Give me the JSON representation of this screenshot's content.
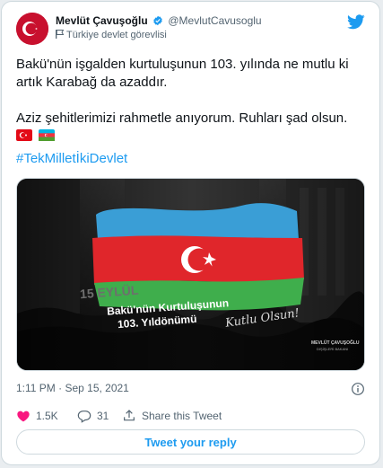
{
  "author": {
    "name": "Mevlüt Çavuşoğlu",
    "handle": "@MevlutCavusoglu",
    "label": "Türkiye devlet görevlisi"
  },
  "tweet": {
    "paragraph1": "Bakü'nün işgalden kurtuluşunun 103. yılında ne mutlu ki artık Karabağ da azaddır.",
    "paragraph2": "Aziz şehitlerimizi rahmetle anıyorum. Ruhları şad olsun.",
    "emoji_flags": [
      "flag-turkey",
      "flag-azerbaijan"
    ],
    "hashtag": "#TekMilletİkiDevlet"
  },
  "media": {
    "date_text": "15 EYLÜL",
    "title_line1": "Bakü'nün Kurtuluşunun",
    "title_line2": "103. Yıldönümü",
    "handwriting": "Kutlu Olsun!",
    "signature_name": "MEVLÜT ÇAVUŞOĞLU",
    "signature_title": "DIŞİŞLERİ BAKANI",
    "colors": {
      "blue": "#3a9ed6",
      "red": "#e0262b",
      "green": "#3fae4c"
    }
  },
  "meta": {
    "timestamp": "1:11 PM · Sep 15, 2021"
  },
  "actions": {
    "likes": "1.5K",
    "replies": "31",
    "share": "Share this Tweet"
  },
  "reply_button": "Tweet your reply",
  "colors": {
    "accent": "#1d9bf0",
    "like": "#f91880",
    "text": "#0f1419",
    "muted": "#536471"
  }
}
